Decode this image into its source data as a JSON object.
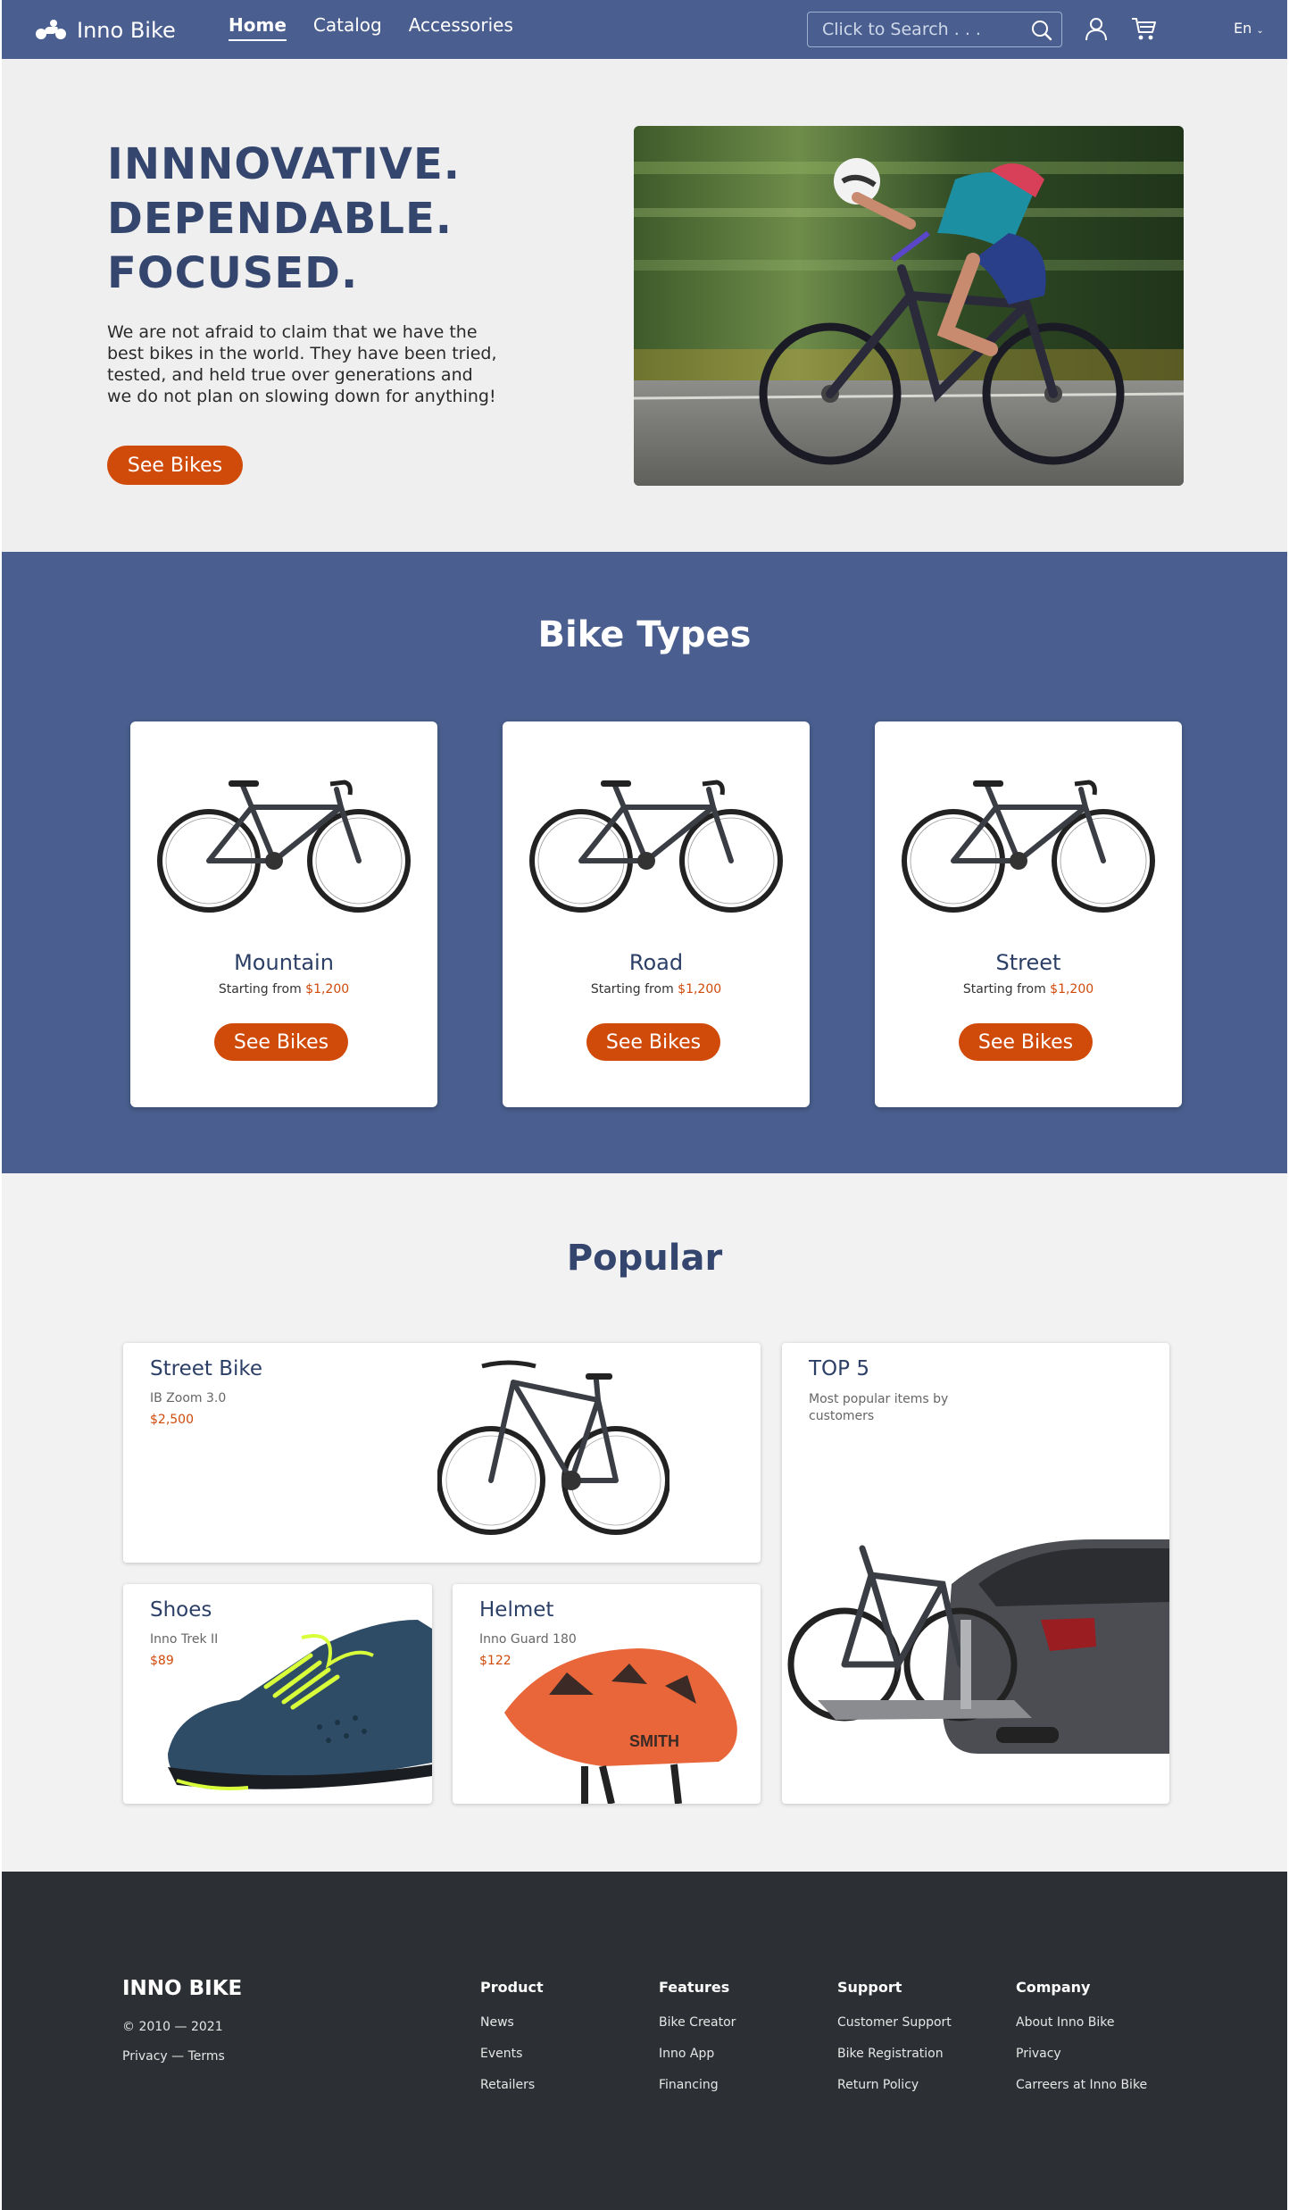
{
  "nav": {
    "brand": "Inno Bike",
    "links": [
      {
        "label": "Home",
        "active": true
      },
      {
        "label": "Catalog",
        "active": false
      },
      {
        "label": "Accessories",
        "active": false
      }
    ],
    "search_placeholder": "Click to Search . . .",
    "language": "En"
  },
  "hero": {
    "title_lines": [
      "INNNOVATIVE.",
      "DEPENDABLE.",
      "FOCUSED."
    ],
    "text": "We are not afraid to claim that we have the best bikes in the world. They have been tried, tested, and held true over generations and we do not plan on slowing down for anything!",
    "button": "See Bikes"
  },
  "types": {
    "title": "Bike Types",
    "cards": [
      {
        "name": "Mountain",
        "price_prefix": "Starting from",
        "price": "$1,200",
        "button": "See Bikes"
      },
      {
        "name": "Road",
        "price_prefix": "Starting from",
        "price": "$1,200",
        "button": "See Bikes"
      },
      {
        "name": "Street",
        "price_prefix": "Starting from",
        "price": "$1,200",
        "button": "See Bikes"
      }
    ]
  },
  "popular": {
    "title": "Popular",
    "street": {
      "name": "Street Bike",
      "model": "IB Zoom 3.0",
      "price": "$2,500"
    },
    "shoes": {
      "name": "Shoes",
      "model": "Inno Trek II",
      "price": "$89"
    },
    "helmet": {
      "name": "Helmet",
      "model": "Inno Guard 180",
      "price": "$122",
      "brand_mark": "SMITH"
    },
    "top5": {
      "name": "TOP 5",
      "sub": "Most popular items by customers"
    }
  },
  "footer": {
    "brand": "INNO BIKE",
    "copyright": "© 2010 — 2021",
    "legal": "Privacy — Terms",
    "columns": [
      {
        "title": "Product",
        "links": [
          "News",
          "Events",
          "Retailers"
        ]
      },
      {
        "title": "Features",
        "links": [
          "Bike Creator",
          "Inno App",
          "Financing"
        ]
      },
      {
        "title": "Support",
        "links": [
          "Customer Support",
          "Bike Registration",
          "Return Policy"
        ]
      },
      {
        "title": "Company",
        "links": [
          "About Inno Bike",
          "Privacy",
          "Carreers at Inno Bike"
        ]
      }
    ]
  },
  "colors": {
    "brand_blue": "#4a5f8f",
    "accent_orange": "#d04a0a",
    "dark_title": "#34456e",
    "footer_bg": "#2c3034"
  }
}
